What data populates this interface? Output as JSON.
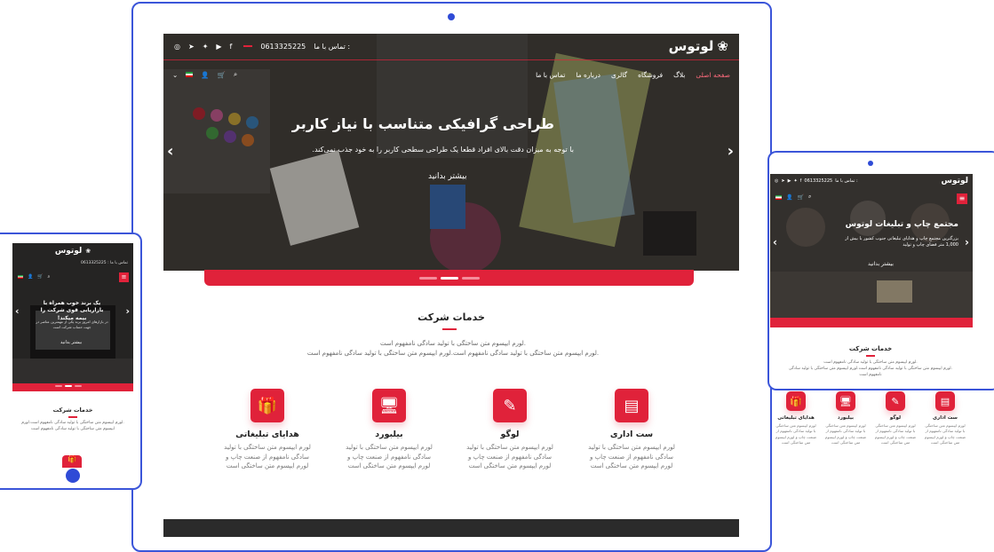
{
  "brand": {
    "name": "لوتوس",
    "logo_icon": "lotus-icon"
  },
  "topbar": {
    "phone_label": "تماس با ما :",
    "phone": "0613325225",
    "social_icons": [
      "instagram-icon",
      "telegram-icon",
      "twitter-icon",
      "whatsapp-icon",
      "youtube-icon",
      "facebook-icon"
    ]
  },
  "nav": {
    "items": [
      "صفحه اصلی",
      "بلاگ",
      "فروشگاه",
      "گالری",
      "درباره ما",
      "تماس با ما"
    ],
    "active": "صفحه اصلی",
    "icons": [
      "search-icon",
      "cart-icon",
      "user-icon",
      "flag-iran-icon",
      "chevron-down-icon"
    ]
  },
  "desktop": {
    "hero_title": "طراحی گرافیکی متناسب با نیاز کاربر",
    "hero_sub": "با توجه به میزان دقت بالای افراد قطعا یک طراحی سطحی کاربر را به خود جذب نمی‌کند.",
    "hero_button": "بیشتر بدانید",
    "services_title": "خدمات شرکت",
    "services_text_1": ".لورم ایپسوم متن ساختگی با تولید سادگی نامفهوم است",
    "services_text_2": ".لورم ایپسوم متن ساختگی با تولید سادگی نامفهوم است.لورم ایپسوم متن ساختگی با تولید سادگی نامفهوم است",
    "services": [
      {
        "title": "ست اداری",
        "icon": "office-set-icon",
        "desc": "لورم ایپسوم متن ساختگی با تولید سادگی نامفهوم از صنعت چاپ و لورم ایپسوم متن ساختگی است"
      },
      {
        "title": "لوگو",
        "icon": "logo-design-icon",
        "desc": "لورم ایپسوم متن ساختگی با تولید سادگی نامفهوم از صنعت چاپ و لورم ایپسوم متن ساختگی است"
      },
      {
        "title": "بیلبورد",
        "icon": "billboard-icon",
        "desc": "لورم ایپسوم متن ساختگی با تولید سادگی نامفهوم از صنعت چاپ و لورم ایپسوم متن ساختگی است"
      },
      {
        "title": "هدایای تبلیغاتی",
        "icon": "gift-icon",
        "desc": "لورم ایپسوم متن ساختگی با تولید سادگی نامفهوم از صنعت چاپ و لورم ایپسوم متن ساختگی است"
      }
    ]
  },
  "tablet": {
    "hero_title": "مجتمع چاپ و تبلیغات لوتوس",
    "hero_sub": "بزرگترین مجتمع چاپ و هدایای تبلیغاتی جنوب کشور با بیش از 1,000 متر فضای چاپ و تولید",
    "hero_button": "بیشتر بدانید",
    "services_title": "خدمات شرکت",
    "services_text_1": ".لورم ایپسوم متن ساختگی با تولید سادگی نامفهوم است",
    "services_text_2": ".لورم ایپسوم متن ساختگی با تولید سادگی نامفهوم است.لورم ایپسوم متن ساختگی با تولید سادگی نامفهوم است",
    "services": [
      {
        "title": "ست اداری",
        "desc": "لورم ایپسوم متن ساختگی با تولید سادگی نامفهوم از صنعت چاپ و لورم ایپسوم متن ساختگی است"
      },
      {
        "title": "لوگو",
        "desc": "لورم ایپسوم متن ساختگی با تولید سادگی نامفهوم از صنعت چاپ و لورم ایپسوم متن ساختگی است"
      },
      {
        "title": "بیلبورد",
        "desc": "لورم ایپسوم متن ساختگی با تولید سادگی نامفهوم از صنعت چاپ و لورم ایپسوم متن ساختگی است"
      },
      {
        "title": "هدایای تبلیغاتی",
        "desc": "لورم ایپسوم متن ساختگی با تولید سادگی نامفهوم از صنعت چاپ و لورم ایپسوم متن ساختگی است"
      }
    ]
  },
  "mobile": {
    "hero_title": "یک برند خوب همراه با بازاریابی قوی شرکت را بیمه میکند!",
    "hero_sub": "در بازارهای امروز برند یکی از مهمترین عناصر در جهت حساب شرکت است",
    "hero_button": "بیشتر بدانید",
    "services_title": "خدمات شرکت",
    "services_text": ".لورم ایپسوم متن ساختگی با تولید سادگی نامفهوم است.لورم ایپسوم متن ساختگی با تولید سادگی نامفهوم است"
  },
  "colors": {
    "accent": "#e0223a",
    "device_frame": "#3b55d9",
    "dark_footer": "#2b2b2b"
  }
}
